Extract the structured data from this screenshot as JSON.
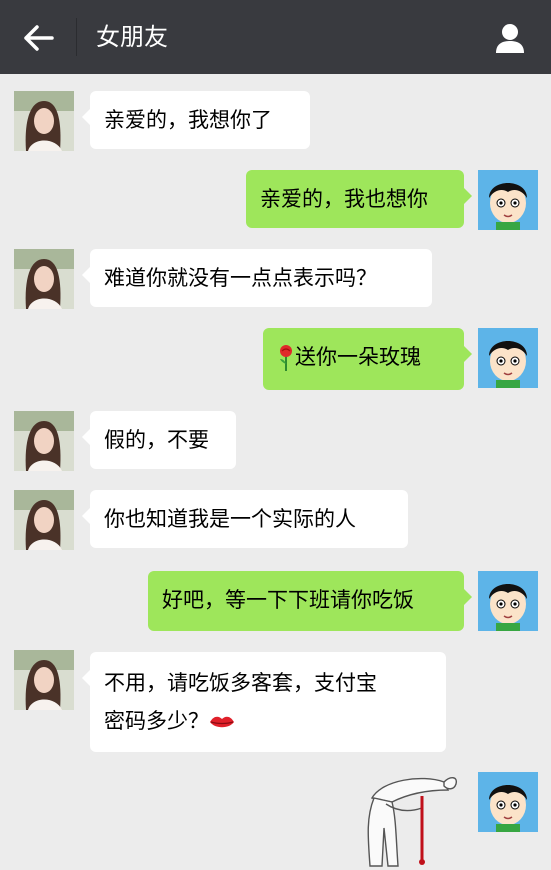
{
  "header": {
    "title": "女朋友",
    "back_icon": "arrow-left-icon",
    "profile_icon": "person-icon",
    "background": "#393a3f"
  },
  "colors": {
    "chat_background": "#ececec",
    "incoming_bubble": "#ffffff",
    "outgoing_bubble": "#9ee65b"
  },
  "messages": [
    {
      "from": "girlfriend",
      "text": "亲爱的，我想你了"
    },
    {
      "from": "me",
      "text": "亲爱的，我也想你"
    },
    {
      "from": "girlfriend",
      "text": "难道你就没有一点点表示吗？"
    },
    {
      "from": "me",
      "emoji": "rose-icon",
      "text": "送你一朵玫瑰"
    },
    {
      "from": "girlfriend",
      "text": "假的，不要"
    },
    {
      "from": "girlfriend",
      "text": "你也知道我是一个实际的人"
    },
    {
      "from": "me",
      "text": "好吧，等一下下班请你吃饭"
    },
    {
      "from": "girlfriend",
      "text_line1": "不用，请吃饭多客套，支付宝",
      "text_line2": "密码多少？",
      "emoji": "lips-icon"
    },
    {
      "from": "me",
      "sticker": "bowing-nosebleed-sticker"
    }
  ]
}
